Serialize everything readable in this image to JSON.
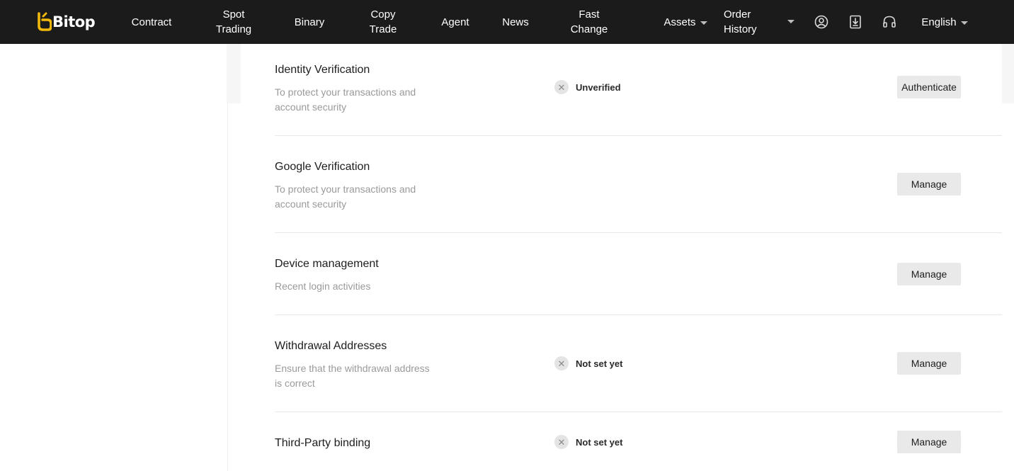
{
  "brand": {
    "name": "Bitop",
    "accent": "#f0b90b"
  },
  "nav": {
    "contract": "Contract",
    "spot_trading": "Spot\nTrading",
    "binary": "Binary",
    "copy_trade": "Copy\nTrade",
    "agent": "Agent",
    "news": "News",
    "fast_change": "Fast\nChange",
    "assets": "Assets",
    "order_history": "Order\nHistory",
    "language": "English",
    "icons": [
      "user-icon",
      "download-icon",
      "headset-icon"
    ]
  },
  "rows": [
    {
      "title": "Identity Verification",
      "desc": "To protect your transactions and account security",
      "status": "Unverified",
      "button": "Authenticate"
    },
    {
      "title": "Google Verification",
      "desc": "To protect your transactions and account security",
      "button": "Manage"
    },
    {
      "title": "Device management",
      "desc": "Recent login activities",
      "button": "Manage"
    },
    {
      "title": "Withdrawal Addresses",
      "desc": "Ensure that the withdrawal address is correct",
      "status": "Not set yet",
      "button": "Manage"
    },
    {
      "title": "Third-Party binding",
      "status": "Not set yet",
      "button": "Manage"
    }
  ],
  "status_icon_glyph": "✕"
}
